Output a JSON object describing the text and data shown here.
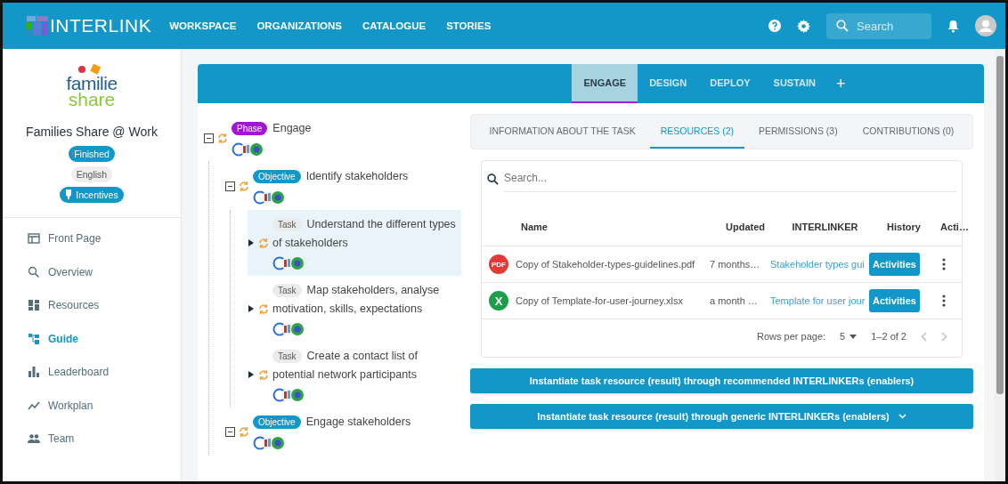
{
  "header": {
    "logo": "INTERLINK",
    "nav": [
      {
        "label": "WORKSPACE"
      },
      {
        "label": "ORGANIZATIONS"
      },
      {
        "label": "CATALOGUE"
      },
      {
        "label": "STORIES"
      }
    ],
    "search": {
      "placeholder": "Search"
    }
  },
  "sidebar": {
    "logo": {
      "line1": "familie",
      "line2": "share"
    },
    "title": "Families Share @ Work",
    "badges": [
      {
        "label": "Finished",
        "kind": "status"
      },
      {
        "label": "English",
        "kind": "language"
      },
      {
        "label": "Incentives",
        "kind": "incentives"
      }
    ],
    "items": [
      {
        "label": "Front Page",
        "kind": "front-page",
        "selected": false
      },
      {
        "label": "Overview",
        "kind": "overview",
        "selected": false
      },
      {
        "label": "Resources",
        "kind": "resources",
        "selected": false
      },
      {
        "label": "Guide",
        "kind": "guide",
        "selected": true
      },
      {
        "label": "Leaderboard",
        "kind": "leaderboard",
        "selected": false
      },
      {
        "label": "Workplan",
        "kind": "workplan",
        "selected": false
      },
      {
        "label": "Team",
        "kind": "team",
        "selected": false
      }
    ]
  },
  "phase_tabs": [
    {
      "label": "ENGAGE",
      "selected": true
    },
    {
      "label": "DESIGN",
      "selected": false
    },
    {
      "label": "DEPLOY",
      "selected": false
    },
    {
      "label": "SUSTAIN",
      "selected": false
    }
  ],
  "add_phase": "+",
  "tree": {
    "kind": "phase",
    "chip": "Phase",
    "title": "Engage",
    "expanded": true,
    "selected": false,
    "children": [
      {
        "kind": "objective",
        "chip": "Objective",
        "title": "Identify stakeholders",
        "expanded": true,
        "selected": false,
        "children": [
          {
            "kind": "task",
            "chip": "Task",
            "title": "Understand the different types of stakeholders",
            "expanded": false,
            "selected": true
          },
          {
            "kind": "task",
            "chip": "Task",
            "title": "Map stakeholders, analyse motivation, skills, expectations",
            "expanded": false,
            "selected": false
          },
          {
            "kind": "task",
            "chip": "Task",
            "title": "Create a contact list of potential network participants",
            "expanded": false,
            "selected": false
          }
        ]
      },
      {
        "kind": "objective",
        "chip": "Objective",
        "title": "Engage stakeholders",
        "expanded": true,
        "selected": false
      }
    ]
  },
  "task_tabs": [
    {
      "label": "INFORMATION ABOUT THE TASK",
      "selected": false
    },
    {
      "label": "RESOURCES (2)",
      "selected": true
    },
    {
      "label": "PERMISSIONS (3)",
      "selected": false
    },
    {
      "label": "CONTRIBUTIONS (0)",
      "selected": false
    }
  ],
  "resources": {
    "search": {
      "placeholder": "Search..."
    },
    "columns": [
      "Name",
      "Updated",
      "INTERLINKER",
      "History",
      "Acti…"
    ],
    "rows": [
      {
        "kind": "pdf",
        "badge": "PDF",
        "name": "Copy of Stakeholder-types-guidelines.pdf",
        "updated": "7 months…",
        "interlinker": "Stakeholder types gui",
        "history": "Activities"
      },
      {
        "kind": "spreadsheet",
        "badge": "X",
        "name": "Copy of Template-for-user-journey.xlsx",
        "updated": "a month …",
        "interlinker": "Template for user jour",
        "history": "Activities"
      }
    ],
    "pagination": {
      "rows_label": "Rows per page:",
      "rows_value": "5",
      "range": "1–2 of 2"
    }
  },
  "actions": [
    {
      "label": "Instantiate task resource (result) through recommended INTERLINKERs (enablers)",
      "dropdown": false
    },
    {
      "label": "Instantiate task resource (result) through generic INTERLINKERs (enablers)",
      "dropdown": true
    }
  ]
}
